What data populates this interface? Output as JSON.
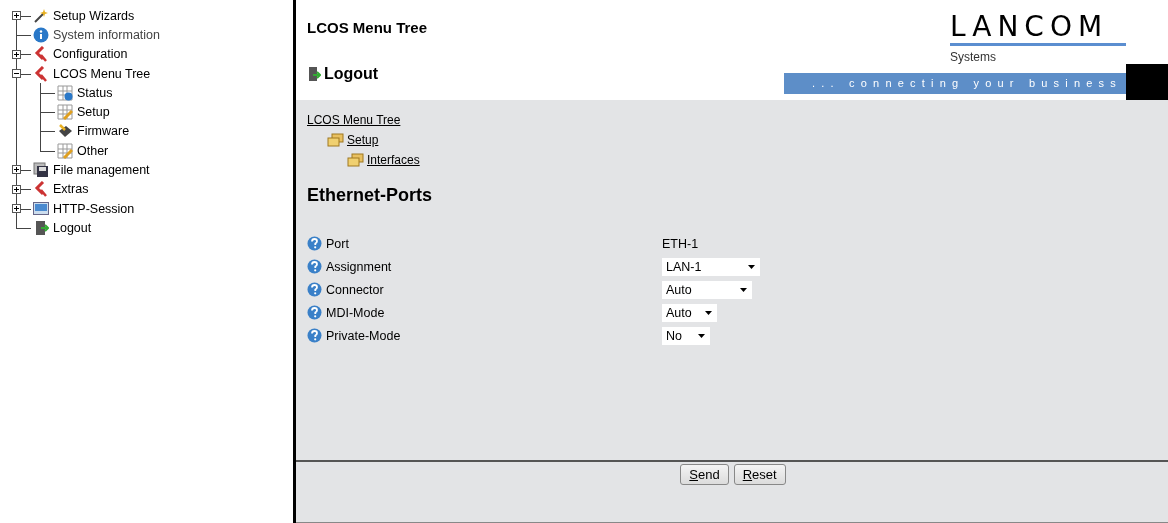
{
  "sidebar": {
    "items": [
      {
        "label": "Setup Wizards",
        "expanded": false
      },
      {
        "label": "System information"
      },
      {
        "label": "Configuration",
        "expanded": false
      },
      {
        "label": "LCOS Menu Tree",
        "expanded": true,
        "children": [
          {
            "label": "Status"
          },
          {
            "label": "Setup"
          },
          {
            "label": "Firmware"
          },
          {
            "label": "Other"
          }
        ]
      },
      {
        "label": "File management",
        "expanded": false
      },
      {
        "label": "Extras",
        "expanded": false
      },
      {
        "label": "HTTP-Session",
        "expanded": false
      },
      {
        "label": "Logout"
      }
    ]
  },
  "header": {
    "title": "LCOS Menu Tree",
    "logout": "Logout",
    "logo": {
      "name": "LANCOM",
      "subtitle": "Systems"
    },
    "tagline": "... connecting your business"
  },
  "breadcrumbs": [
    "LCOS Menu Tree",
    "Setup",
    "Interfaces"
  ],
  "heading": "Ethernet-Ports",
  "fields": [
    {
      "label": "Port",
      "kind": "text",
      "value": "ETH-1"
    },
    {
      "label": "Assignment",
      "kind": "select",
      "value": "LAN-1"
    },
    {
      "label": "Connector",
      "kind": "select",
      "value": "Auto"
    },
    {
      "label": "MDI-Mode",
      "kind": "select",
      "value": "Auto"
    },
    {
      "label": "Private-Mode",
      "kind": "select",
      "value": "No"
    }
  ],
  "buttons": [
    "Send",
    "Reset"
  ]
}
